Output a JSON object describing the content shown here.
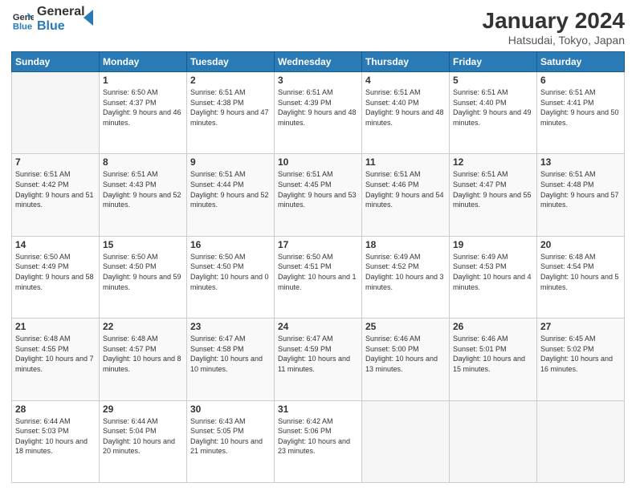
{
  "logo": {
    "line1": "General",
    "line2": "Blue"
  },
  "title": "January 2024",
  "location": "Hatsudai, Tokyo, Japan",
  "days_of_week": [
    "Sunday",
    "Monday",
    "Tuesday",
    "Wednesday",
    "Thursday",
    "Friday",
    "Saturday"
  ],
  "weeks": [
    [
      {
        "day": "",
        "empty": true
      },
      {
        "day": "1",
        "sunrise": "6:50 AM",
        "sunset": "4:37 PM",
        "daylight": "9 hours and 46 minutes."
      },
      {
        "day": "2",
        "sunrise": "6:51 AM",
        "sunset": "4:38 PM",
        "daylight": "9 hours and 47 minutes."
      },
      {
        "day": "3",
        "sunrise": "6:51 AM",
        "sunset": "4:39 PM",
        "daylight": "9 hours and 48 minutes."
      },
      {
        "day": "4",
        "sunrise": "6:51 AM",
        "sunset": "4:40 PM",
        "daylight": "9 hours and 48 minutes."
      },
      {
        "day": "5",
        "sunrise": "6:51 AM",
        "sunset": "4:40 PM",
        "daylight": "9 hours and 49 minutes."
      },
      {
        "day": "6",
        "sunrise": "6:51 AM",
        "sunset": "4:41 PM",
        "daylight": "9 hours and 50 minutes."
      }
    ],
    [
      {
        "day": "7",
        "sunrise": "6:51 AM",
        "sunset": "4:42 PM",
        "daylight": "9 hours and 51 minutes."
      },
      {
        "day": "8",
        "sunrise": "6:51 AM",
        "sunset": "4:43 PM",
        "daylight": "9 hours and 52 minutes."
      },
      {
        "day": "9",
        "sunrise": "6:51 AM",
        "sunset": "4:44 PM",
        "daylight": "9 hours and 52 minutes."
      },
      {
        "day": "10",
        "sunrise": "6:51 AM",
        "sunset": "4:45 PM",
        "daylight": "9 hours and 53 minutes."
      },
      {
        "day": "11",
        "sunrise": "6:51 AM",
        "sunset": "4:46 PM",
        "daylight": "9 hours and 54 minutes."
      },
      {
        "day": "12",
        "sunrise": "6:51 AM",
        "sunset": "4:47 PM",
        "daylight": "9 hours and 55 minutes."
      },
      {
        "day": "13",
        "sunrise": "6:51 AM",
        "sunset": "4:48 PM",
        "daylight": "9 hours and 57 minutes."
      }
    ],
    [
      {
        "day": "14",
        "sunrise": "6:50 AM",
        "sunset": "4:49 PM",
        "daylight": "9 hours and 58 minutes."
      },
      {
        "day": "15",
        "sunrise": "6:50 AM",
        "sunset": "4:50 PM",
        "daylight": "9 hours and 59 minutes."
      },
      {
        "day": "16",
        "sunrise": "6:50 AM",
        "sunset": "4:50 PM",
        "daylight": "10 hours and 0 minutes."
      },
      {
        "day": "17",
        "sunrise": "6:50 AM",
        "sunset": "4:51 PM",
        "daylight": "10 hours and 1 minute."
      },
      {
        "day": "18",
        "sunrise": "6:49 AM",
        "sunset": "4:52 PM",
        "daylight": "10 hours and 3 minutes."
      },
      {
        "day": "19",
        "sunrise": "6:49 AM",
        "sunset": "4:53 PM",
        "daylight": "10 hours and 4 minutes."
      },
      {
        "day": "20",
        "sunrise": "6:48 AM",
        "sunset": "4:54 PM",
        "daylight": "10 hours and 5 minutes."
      }
    ],
    [
      {
        "day": "21",
        "sunrise": "6:48 AM",
        "sunset": "4:55 PM",
        "daylight": "10 hours and 7 minutes."
      },
      {
        "day": "22",
        "sunrise": "6:48 AM",
        "sunset": "4:57 PM",
        "daylight": "10 hours and 8 minutes."
      },
      {
        "day": "23",
        "sunrise": "6:47 AM",
        "sunset": "4:58 PM",
        "daylight": "10 hours and 10 minutes."
      },
      {
        "day": "24",
        "sunrise": "6:47 AM",
        "sunset": "4:59 PM",
        "daylight": "10 hours and 11 minutes."
      },
      {
        "day": "25",
        "sunrise": "6:46 AM",
        "sunset": "5:00 PM",
        "daylight": "10 hours and 13 minutes."
      },
      {
        "day": "26",
        "sunrise": "6:46 AM",
        "sunset": "5:01 PM",
        "daylight": "10 hours and 15 minutes."
      },
      {
        "day": "27",
        "sunrise": "6:45 AM",
        "sunset": "5:02 PM",
        "daylight": "10 hours and 16 minutes."
      }
    ],
    [
      {
        "day": "28",
        "sunrise": "6:44 AM",
        "sunset": "5:03 PM",
        "daylight": "10 hours and 18 minutes."
      },
      {
        "day": "29",
        "sunrise": "6:44 AM",
        "sunset": "5:04 PM",
        "daylight": "10 hours and 20 minutes."
      },
      {
        "day": "30",
        "sunrise": "6:43 AM",
        "sunset": "5:05 PM",
        "daylight": "10 hours and 21 minutes."
      },
      {
        "day": "31",
        "sunrise": "6:42 AM",
        "sunset": "5:06 PM",
        "daylight": "10 hours and 23 minutes."
      },
      {
        "day": "",
        "empty": true
      },
      {
        "day": "",
        "empty": true
      },
      {
        "day": "",
        "empty": true
      }
    ]
  ]
}
